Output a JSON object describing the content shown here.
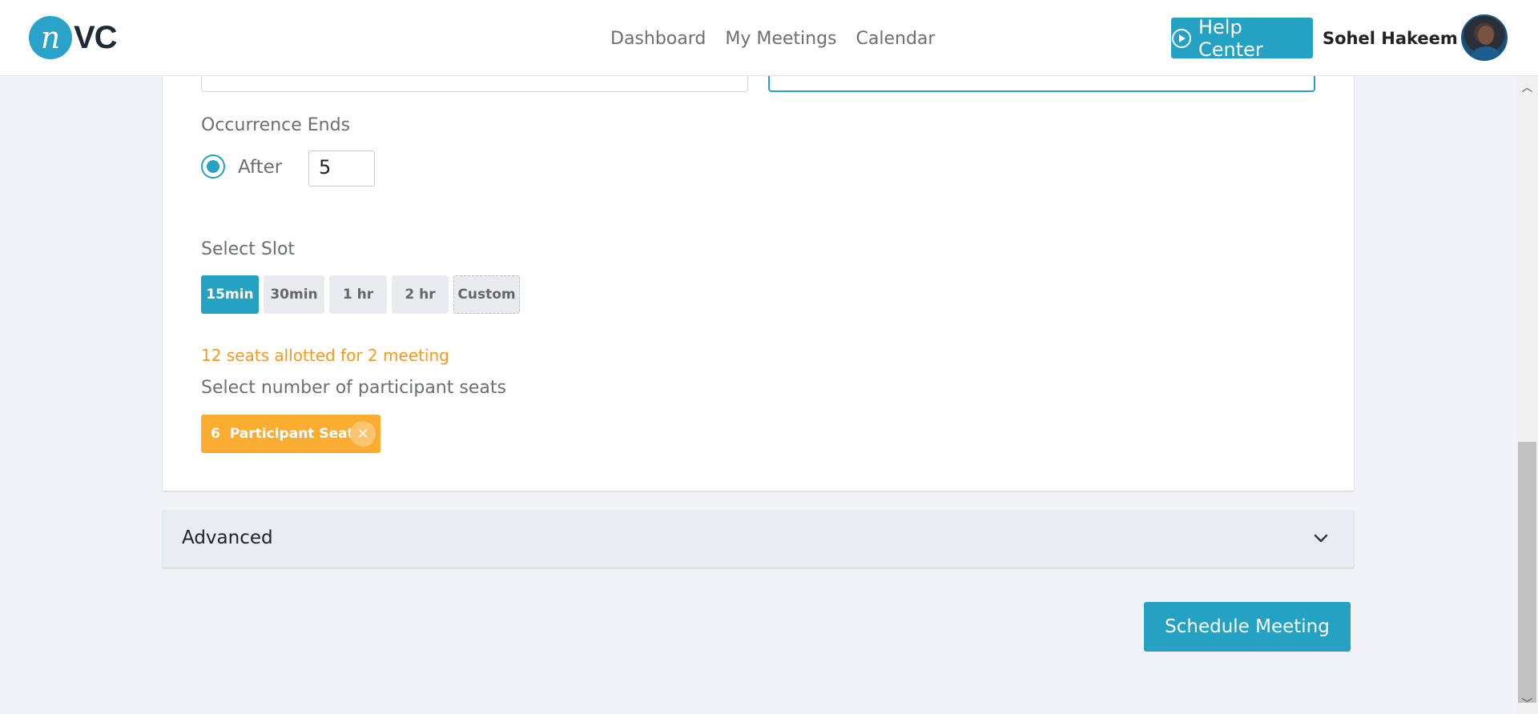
{
  "header": {
    "logo_letter": "n",
    "logo_text": "VC",
    "nav": [
      {
        "label": "Dashboard"
      },
      {
        "label": "My Meetings"
      },
      {
        "label": "Calendar"
      }
    ],
    "help_center_label": "Help Center",
    "user_name": "Sohel Hakeem"
  },
  "form": {
    "occurrence_ends_label": "Occurrence Ends",
    "occurrence_option_label": "After",
    "occurrence_count": "5",
    "select_slot_label": "Select Slot",
    "slots": [
      {
        "label": "15min",
        "selected": true
      },
      {
        "label": "30min",
        "selected": false
      },
      {
        "label": "1 hr",
        "selected": false
      },
      {
        "label": "2 hr",
        "selected": false
      },
      {
        "label": "Custom",
        "selected": false
      }
    ],
    "seats_allotted_text": "12 seats allotted for 2 meeting",
    "participant_seats_label": "Select number of participant seats",
    "seat_tag": {
      "count": "6",
      "label": "Participant Seats"
    }
  },
  "advanced": {
    "label": "Advanced"
  },
  "actions": {
    "schedule_label": "Schedule Meeting"
  },
  "colors": {
    "accent": "#25a2c3",
    "seats_tag": "#fbad32",
    "warning_text": "#f29a1f"
  }
}
